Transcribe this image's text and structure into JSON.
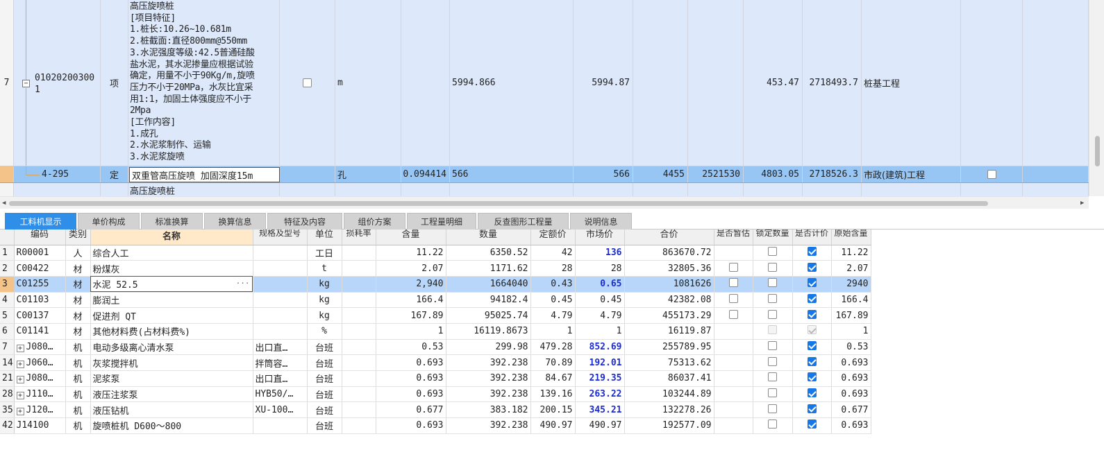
{
  "top_grid": {
    "row7": {
      "index": "7",
      "code": "01020200300\n1",
      "category": "项",
      "spec": "高压旋喷桩\n[项目特征]\n1.桩长:10.26~10.681m\n2.桩截面:直径800mm@550mm\n3.水泥强度等级:42.5普通硅酸\n盐水泥，其水泥掺量应根据试验\n确定，用量不小于90Kg/m,旋喷\n压力不小于20MPa，水灰比宜采\n用1:1，加固土体强度应不小于\n2Mpa\n[工作内容]\n1.成孔\n2.水泥浆制作、运输\n3.水泥浆旋喷",
      "unit": "m",
      "quantity_expr": "5994.866",
      "quantity": "5994.87",
      "unit_price": "453.47",
      "total": "2718493.7",
      "profession": "桩基工程"
    },
    "row8": {
      "code": "4-295",
      "category": "定",
      "name": "双重管高压旋喷 加固深度15m",
      "unit": "孔",
      "content": "0.094414",
      "quantity_expr": "566",
      "quantity": "566",
      "v1": "4455",
      "v2": "2521530",
      "unit_price": "4803.05",
      "total": "2718526.3",
      "profession": "市政(建筑)工程"
    },
    "row9": {
      "spec": "高压旋喷桩"
    }
  },
  "tabs": [
    "工料机显示",
    "单价构成",
    "标准换算",
    "换算信息",
    "特征及内容",
    "组价方案",
    "工程量明细",
    "反查图形工程量",
    "说明信息"
  ],
  "bottom_grid": {
    "headers": [
      "",
      "编码",
      "类别",
      "名称",
      "规格及型号",
      "单位",
      "损耗率",
      "含量",
      "数量",
      "定额价",
      "市场价",
      "合价",
      "是否暂估",
      "锁定数量",
      "是否计价",
      "原始含量"
    ],
    "rows": [
      {
        "idx": "1",
        "code": "R00001",
        "expand": false,
        "cat": "人",
        "name": "综合人工",
        "spec": "",
        "unit": "工日",
        "loss": "",
        "content": "11.22",
        "qty": "6350.52",
        "quota": "42",
        "market": "136",
        "market_hl": true,
        "total": "863670.72",
        "est": null,
        "lock": "off",
        "price": "on",
        "orig": "11.22"
      },
      {
        "idx": "2",
        "code": "C00422",
        "expand": false,
        "cat": "材",
        "name": "粉煤灰",
        "spec": "",
        "unit": "t",
        "loss": "",
        "content": "2.07",
        "qty": "1171.62",
        "quota": "28",
        "market": "28",
        "market_hl": false,
        "total": "32805.36",
        "est": "off",
        "lock": "off",
        "price": "on",
        "orig": "2.07"
      },
      {
        "idx": "3",
        "code": "C01255",
        "expand": false,
        "cat": "材",
        "name": "水泥 52.5",
        "spec": "",
        "unit": "kg",
        "loss": "",
        "content": "2,940",
        "qty": "1664040",
        "quota": "0.43",
        "market": "0.65",
        "market_hl": true,
        "total": "1081626",
        "est": "off",
        "lock": "off",
        "price": "on",
        "orig": "2940",
        "selected": true
      },
      {
        "idx": "4",
        "code": "C01103",
        "expand": false,
        "cat": "材",
        "name": "膨润土",
        "spec": "",
        "unit": "kg",
        "loss": "",
        "content": "166.4",
        "qty": "94182.4",
        "quota": "0.45",
        "market": "0.45",
        "market_hl": false,
        "total": "42382.08",
        "est": "off",
        "lock": "off",
        "price": "on",
        "orig": "166.4"
      },
      {
        "idx": "5",
        "code": "C00137",
        "expand": false,
        "cat": "材",
        "name": "促进剂 QT",
        "spec": "",
        "unit": "kg",
        "loss": "",
        "content": "167.89",
        "qty": "95025.74",
        "quota": "4.79",
        "market": "4.79",
        "market_hl": false,
        "total": "455173.29",
        "est": "off",
        "lock": "off",
        "price": "on",
        "orig": "167.89"
      },
      {
        "idx": "6",
        "code": "C01141",
        "expand": false,
        "cat": "材",
        "name": "其他材料费(占材料费%)",
        "spec": "",
        "unit": "%",
        "loss": "",
        "content": "1",
        "qty": "16119.8673",
        "quota": "1",
        "market": "1",
        "market_hl": false,
        "total": "16119.87",
        "est": null,
        "lock": "dis",
        "price": "dis-on",
        "orig": "1"
      },
      {
        "idx": "7",
        "code": "J080…",
        "expand": true,
        "cat": "机",
        "name": "电动多级离心清水泵",
        "spec": "出口直…",
        "unit": "台班",
        "loss": "",
        "content": "0.53",
        "qty": "299.98",
        "quota": "479.28",
        "market": "852.69",
        "market_hl": true,
        "total": "255789.95",
        "est": null,
        "lock": "off",
        "price": "on",
        "orig": "0.53"
      },
      {
        "idx": "14",
        "code": "J060…",
        "expand": true,
        "cat": "机",
        "name": "灰浆搅拌机",
        "spec": "拌筒容…",
        "unit": "台班",
        "loss": "",
        "content": "0.693",
        "qty": "392.238",
        "quota": "70.89",
        "market": "192.01",
        "market_hl": true,
        "total": "75313.62",
        "est": null,
        "lock": "off",
        "price": "on",
        "orig": "0.693"
      },
      {
        "idx": "21",
        "code": "J080…",
        "expand": true,
        "cat": "机",
        "name": "泥浆泵",
        "spec": "出口直…",
        "unit": "台班",
        "loss": "",
        "content": "0.693",
        "qty": "392.238",
        "quota": "84.67",
        "market": "219.35",
        "market_hl": true,
        "total": "86037.41",
        "est": null,
        "lock": "off",
        "price": "on",
        "orig": "0.693"
      },
      {
        "idx": "28",
        "code": "J110…",
        "expand": true,
        "cat": "机",
        "name": "液压注浆泵",
        "spec": "HYB50/…",
        "unit": "台班",
        "loss": "",
        "content": "0.693",
        "qty": "392.238",
        "quota": "139.16",
        "market": "263.22",
        "market_hl": true,
        "total": "103244.89",
        "est": null,
        "lock": "off",
        "price": "on",
        "orig": "0.693"
      },
      {
        "idx": "35",
        "code": "J120…",
        "expand": true,
        "cat": "机",
        "name": "液压钻机",
        "spec": "XU-100…",
        "unit": "台班",
        "loss": "",
        "content": "0.677",
        "qty": "383.182",
        "quota": "200.15",
        "market": "345.21",
        "market_hl": true,
        "total": "132278.26",
        "est": null,
        "lock": "off",
        "price": "on",
        "orig": "0.677"
      },
      {
        "idx": "42",
        "code": "J14100",
        "expand": false,
        "cat": "机",
        "name": "旋喷桩机 D600～800",
        "spec": "",
        "unit": "台班",
        "loss": "",
        "content": "0.693",
        "qty": "392.238",
        "quota": "490.97",
        "market": "490.97",
        "market_hl": false,
        "total": "192577.09",
        "est": null,
        "lock": "off",
        "price": "on",
        "orig": "0.693"
      }
    ]
  }
}
